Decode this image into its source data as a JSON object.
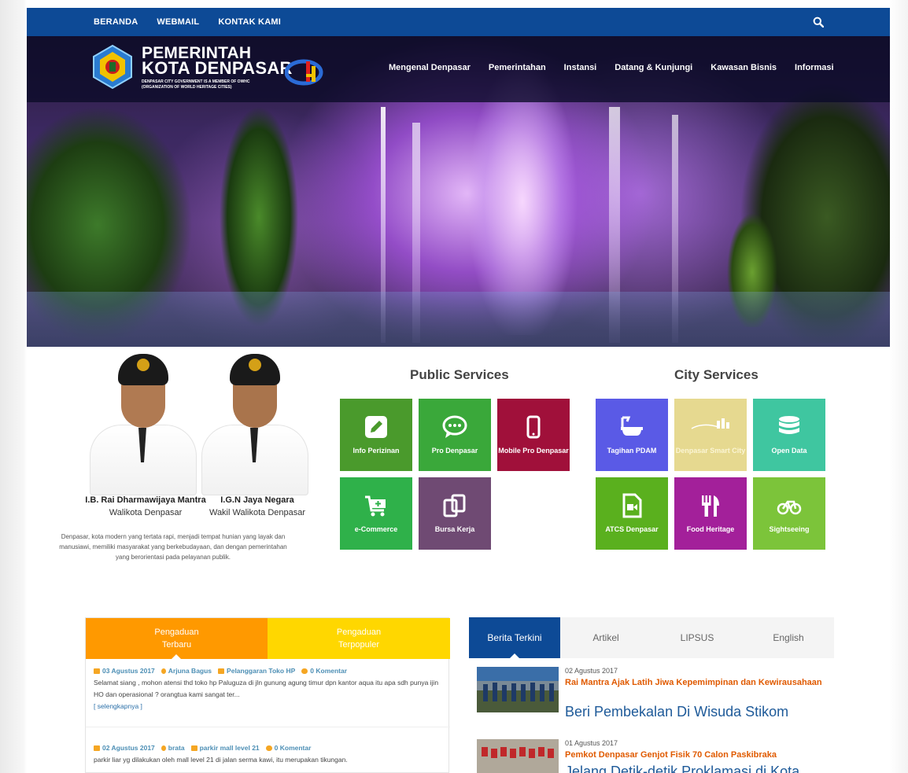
{
  "topbar": {
    "links": [
      "BERANDA",
      "WEBMAIL",
      "KONTAK KAMI"
    ],
    "search_icon": "search-icon"
  },
  "header": {
    "title_line1": "PEMERINTAH",
    "title_line2": "KOTA DENPASAR",
    "subtitle_line1": "DENPASAR CITY GOVERNMENT IS A MEMBER OF OWHC",
    "subtitle_line2": "(ORGANIZATION OF WORLD HERITAGE CITIES)"
  },
  "nav": {
    "items": [
      "Mengenal Denpasar",
      "Pemerintahan",
      "Instansi",
      "Datang & Kunjungi",
      "Kawasan Bisnis",
      "Informasi"
    ]
  },
  "officials": {
    "mayor_name": "I.B. Rai Dharmawijaya Mantra",
    "mayor_role": "Walikota Denpasar",
    "vice_name": "I.G.N Jaya Negara",
    "vice_role": "Wakil Walikota Denpasar",
    "description": "Denpasar, kota modern yang tertata rapi, menjadi tempat hunian yang layak dan manusiawi, memiliki masyarakat yang berkebudayaan, dan dengan pemerintahan yang berorientasi pada pelayanan publik."
  },
  "public_services": {
    "title": "Public Services",
    "tiles": [
      {
        "label": "Info Perizinan",
        "color": "#4a9a2c",
        "icon": "pencil-icon"
      },
      {
        "label": "Pro Denpasar",
        "color": "#3aa83a",
        "icon": "chat-icon"
      },
      {
        "label": "Mobile Pro Denpasar",
        "color": "#a0103a",
        "icon": "mobile-icon"
      },
      {
        "label": "e-Commerce",
        "color": "#2fb14a",
        "icon": "cart-icon"
      },
      {
        "label": "Bursa Kerja",
        "color": "#6f4a73",
        "icon": "copy-icon"
      }
    ]
  },
  "city_services": {
    "title": "City Services",
    "tiles": [
      {
        "label": "Tagihan PDAM",
        "color": "#5a5ae6",
        "icon": "bathtub-icon"
      },
      {
        "label": "Denpasar Smart City",
        "color": "#e6d990",
        "icon": "smartcity-logo-icon"
      },
      {
        "label": "Open Data",
        "color": "#3fc6a0",
        "icon": "database-icon"
      },
      {
        "label": "ATCS Denpasar",
        "color": "#5ab01e",
        "icon": "video-file-icon"
      },
      {
        "label": "Food Heritage",
        "color": "#a3209a",
        "icon": "utensils-icon"
      },
      {
        "label": "Sightseeing",
        "color": "#7cc43a",
        "icon": "bicycle-icon"
      }
    ]
  },
  "pengaduan": {
    "tab1": [
      "Pengaduan",
      "Terbaru"
    ],
    "tab2": [
      "Pengaduan",
      "Terpopuler"
    ],
    "items": [
      {
        "date": "03 Agustus 2017",
        "author": "Arjuna Bagus",
        "category": "Pelanggaran Toko HP",
        "comments": "0 Komentar",
        "text": "Selamat siang , mohon atensi thd toko hp Paluguza di jln gunung agung timur dpn kantor aqua itu apa sdh punya ijin HO dan operasional ? orangtua kami sangat ter...",
        "more": "[ selengkapnya ]"
      },
      {
        "date": "02 Agustus 2017",
        "author": "brata",
        "category": "parkir mall level 21",
        "comments": "0 Komentar",
        "text": "parkir liar yg dilakukan oleh mall level 21 di jalan serma kawi, itu merupakan tikungan."
      }
    ]
  },
  "berita": {
    "tabs": [
      "Berita Terkini",
      "Artikel",
      "LIPSUS",
      "English"
    ],
    "items": [
      {
        "date": "02 Agustus 2017",
        "headline": "Rai Mantra Ajak Latih Jiwa Kepemimpinan dan Kewirausahaan",
        "subhead": "Beri Pembekalan Di Wisuda Stikom"
      },
      {
        "date": "01 Agustus 2017",
        "headline": "Pemkot Denpasar Genjot Fisik 70 Calon Paskibraka",
        "subhead": "Jelang Detik-detik Proklamasi di Kota"
      }
    ]
  }
}
